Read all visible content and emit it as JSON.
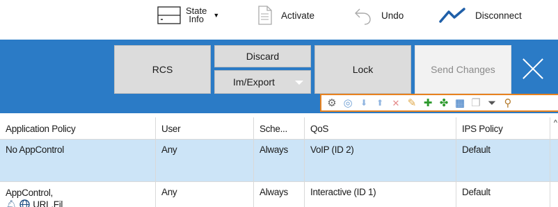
{
  "toolbar": {
    "state_line1": "State",
    "state_line2": "Info",
    "activate": "Activate",
    "undo": "Undo",
    "disconnect": "Disconnect",
    "icons": [
      "server-icon",
      "document-icon",
      "undo-arrow-icon",
      "connection-line-icon"
    ]
  },
  "actions": {
    "rcs": "RCS",
    "discard": "Discard",
    "im_export": "Im/Export",
    "lock": "Lock",
    "send_changes": "Send Changes"
  },
  "colors": {
    "band": "#2b7bc6",
    "selected_row": "#cce4f7",
    "iconbar_border": "#e8821f"
  },
  "table": {
    "columns": [
      "Application Policy",
      "User",
      "Sche...",
      "QoS",
      "IPS Policy"
    ],
    "rows": [
      {
        "policy": "No AppControl",
        "user": "Any",
        "schedule": "Always",
        "qos": "VoIP (ID 2)",
        "ips": "Default"
      },
      {
        "policy": "AppControl,",
        "policy_sub": "URL.Fil",
        "user": "Any",
        "schedule": "Always",
        "qos": "Interactive (ID 1)",
        "ips": "Default"
      }
    ]
  }
}
